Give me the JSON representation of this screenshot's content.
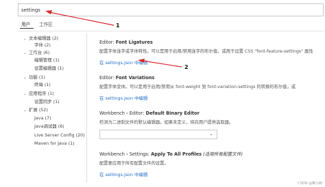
{
  "search": {
    "value": "settings"
  },
  "tabs": [
    {
      "label": "用户"
    },
    {
      "label": "工作区"
    }
  ],
  "tree": [
    {
      "label": "文本编辑器 (2)",
      "expanded": true
    },
    {
      "label": "字体 (2)"
    },
    {
      "label": "工作台 (6)",
      "expanded": true
    },
    {
      "label": "编辑管理 (1)"
    },
    {
      "label": "设置编辑器 (1)"
    },
    {
      "label": "功能 (1)",
      "expanded": true
    },
    {
      "label": "终端 (1)"
    },
    {
      "label": "应用程序 (1)",
      "expanded": true
    },
    {
      "label": "设置同步 (1)"
    },
    {
      "label": "扩展 (52)",
      "expanded": true
    },
    {
      "label": "Java (7)"
    },
    {
      "label": "Java调试器 (6)"
    },
    {
      "label": "Live Server Config (20)"
    },
    {
      "label": "Maven for Java (1)"
    }
  ],
  "settings": [
    {
      "title_prefix": "Editor: ",
      "title_bold": "Font Ligatures",
      "description": "配置字体连字或字体特性。可以是用于启用/禁用连字的布尔值，或用于设置 CSS \"font-feature-settings\" 属性",
      "link": "在 settings.json 中编辑"
    },
    {
      "title_prefix": "Editor: ",
      "title_bold": "Font Variations",
      "description": "配置字体变体。可以是用于启用/禁用从 font-weight 到 font-variation-settings 的转换的布尔值，或",
      "link": "在 settings.json 中编辑"
    },
    {
      "title_prefix": "Workbench › Editor: ",
      "title_bold": "Default Binary Editor",
      "description": "检测为二进制文件的默认编辑器。如果未定义，将向用户提供选取器。"
    },
    {
      "title_prefix": "Workbench › Settings: ",
      "title_bold": "Apply To All Profiles",
      "title_suffix": " (适用所有配置文件)",
      "description": "配置要应用于所有配置文件的设置。",
      "link": "在 settings.json 中编辑"
    }
  ],
  "annotations": [
    {
      "label": "1"
    },
    {
      "label": "2"
    }
  ],
  "watermark": "CSDN @某小郎",
  "colors": {
    "link": "#1f6fc5",
    "arrow": "#d9262c"
  }
}
